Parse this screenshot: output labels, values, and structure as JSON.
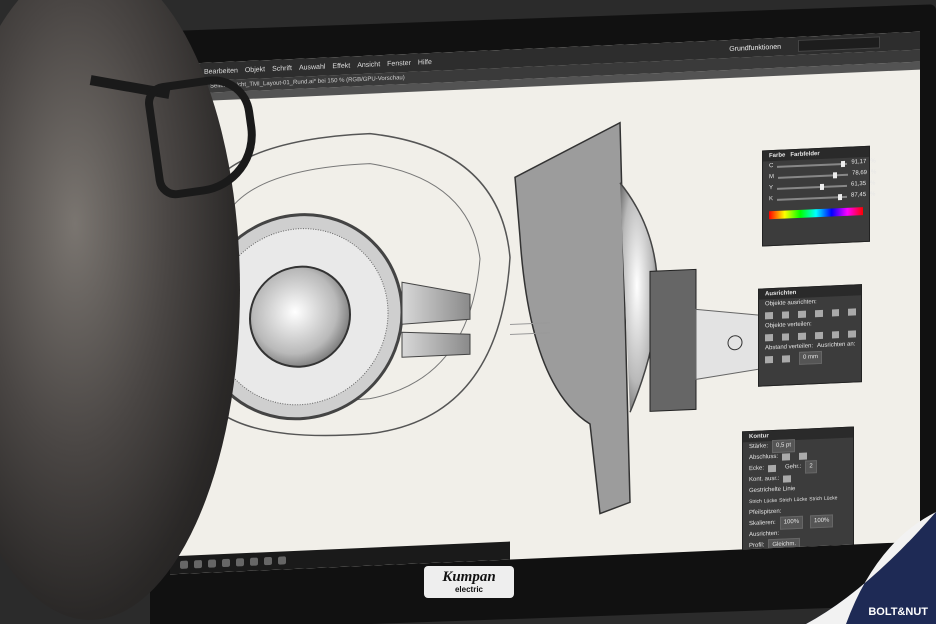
{
  "app": {
    "menu": [
      "Bearbeiten",
      "Objekt",
      "Schrift",
      "Auswahl",
      "Effekt",
      "Ansicht",
      "Fenster",
      "Hilfe"
    ],
    "workspace": "Grundfunktionen",
    "tab": "Seitenansicht_TMI_Layout-01_Rund.ai* bei 150 % (RGB/GPU-Vorschau)"
  },
  "panels": {
    "farbe": {
      "title": "Farbe",
      "tab2": "Farbfelder",
      "channels": [
        {
          "label": "C",
          "value": "91,17",
          "unit": "%",
          "fraction": 0.91
        },
        {
          "label": "M",
          "value": "78,69",
          "unit": "%",
          "fraction": 0.79
        },
        {
          "label": "Y",
          "value": "61,35",
          "unit": "%",
          "fraction": 0.61
        },
        {
          "label": "K",
          "value": "87,45",
          "unit": "%",
          "fraction": 0.87
        }
      ]
    },
    "ausrichten": {
      "title": "Ausrichten",
      "section1": "Objekte ausrichten:",
      "section2": "Objekte verteilen:",
      "section3": "Abstand verteilen:",
      "section4": "Ausrichten an:",
      "spacing": "0 mm"
    },
    "kontur": {
      "title": "Kontur",
      "staerke_label": "Stärke:",
      "staerke_value": "0,5 pt",
      "abschluss": "Abschluss:",
      "ecke": "Ecke:",
      "gehrung": "Gehr.:",
      "gehrung_value": "2",
      "kontur_ausr": "Kont. ausr.:",
      "gestrichelt": "Gestrichelte Linie",
      "dash_labels": [
        "Strich",
        "Lücke",
        "Strich",
        "Lücke",
        "Strich",
        "Lücke"
      ],
      "pfeilspitzen": "Pfeilspitzen:",
      "skalieren": "Skalieren:",
      "ausrichten": "Ausrichten:",
      "skal1": "100%",
      "skal2": "100%",
      "profil": "Profil:",
      "profil_value": "Gleichm."
    }
  },
  "logo": {
    "text": "Kumpan",
    "sub": "electric"
  },
  "watermark": {
    "text": "BOLT&NUT"
  }
}
